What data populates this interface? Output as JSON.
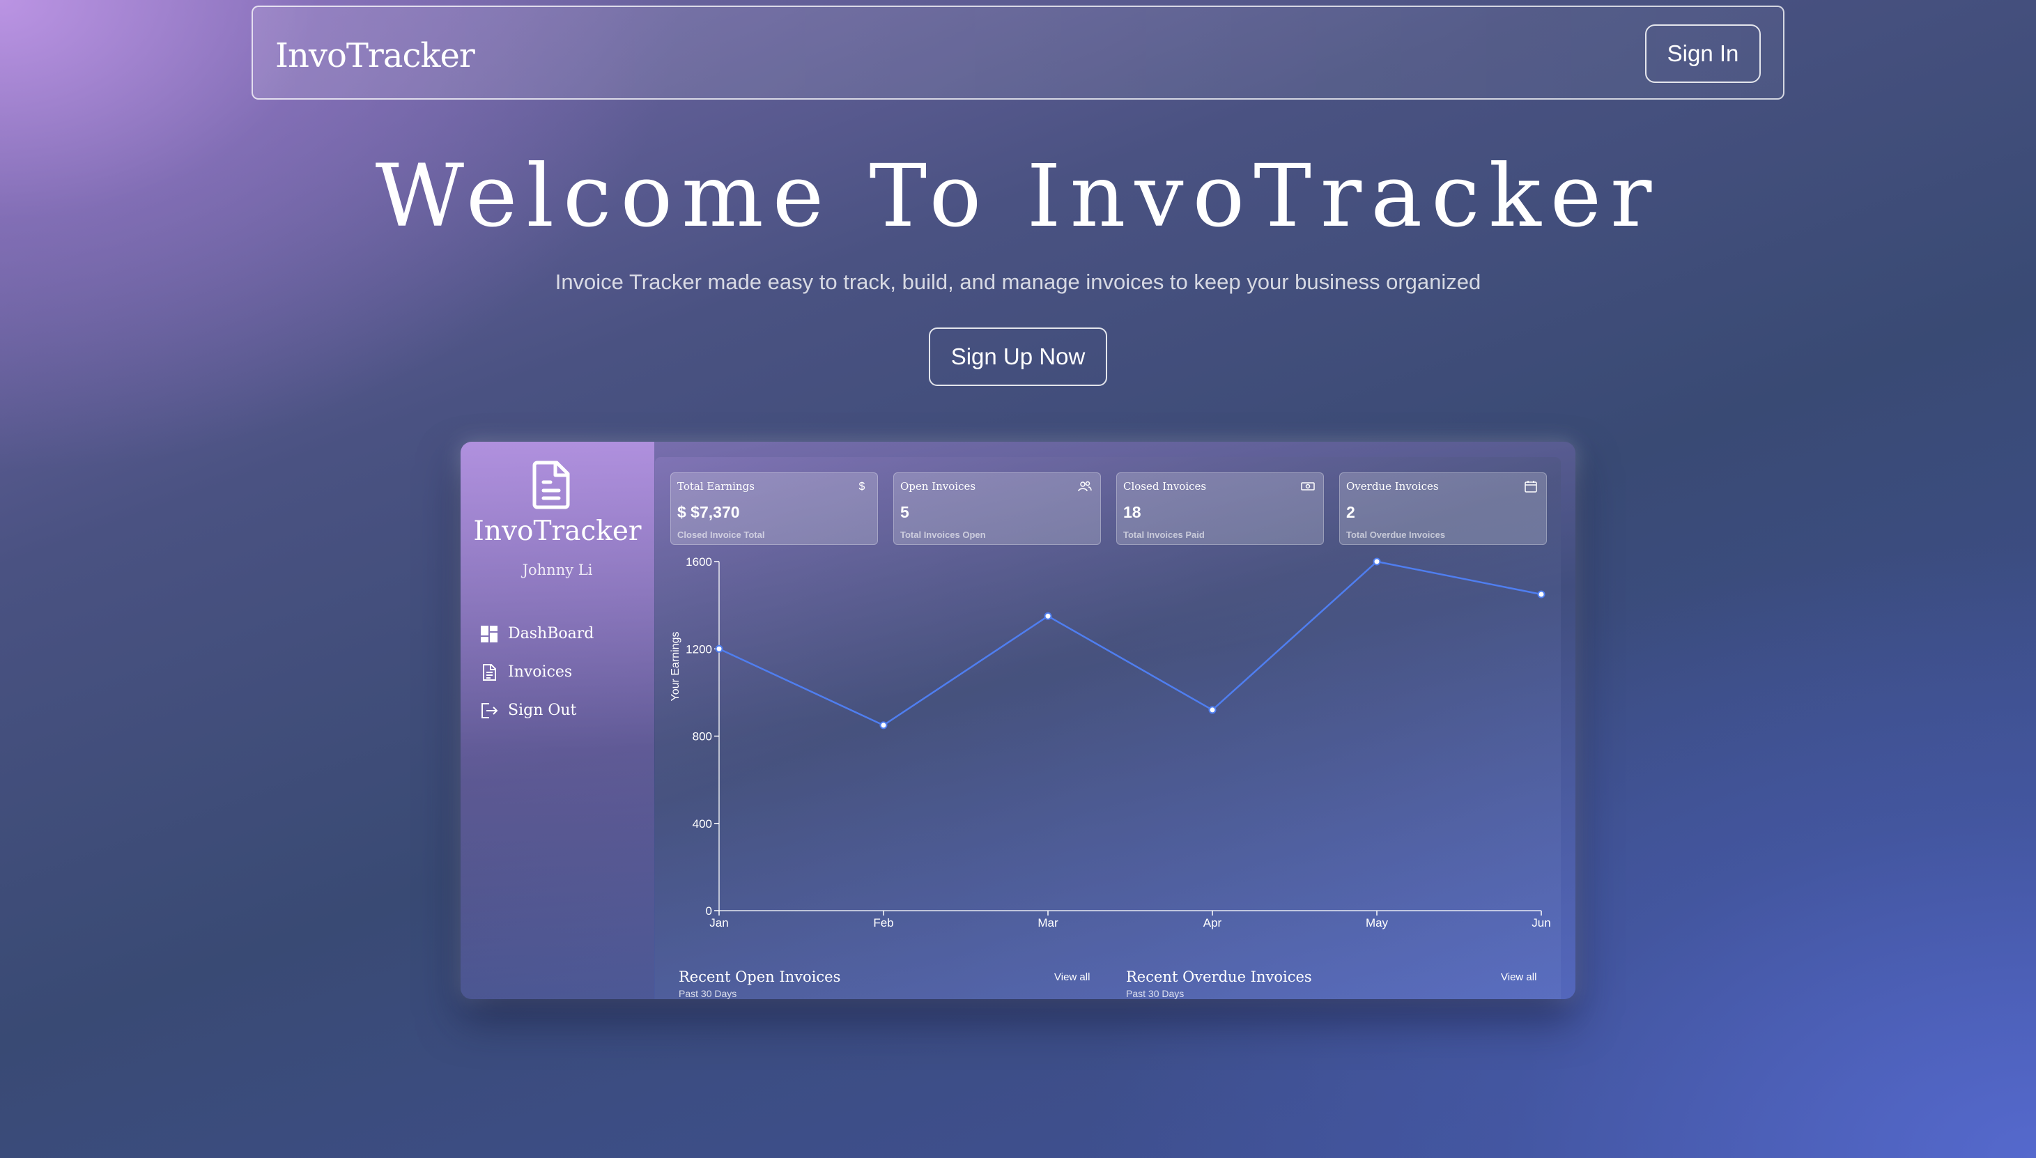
{
  "navbar": {
    "brand": "InvoTracker",
    "signin_label": "Sign In"
  },
  "hero": {
    "title": "Welcome To InvoTracker",
    "subtitle": "Invoice Tracker made easy to track, build, and manage invoices to keep your business organized",
    "cta_label": "Sign Up Now"
  },
  "preview": {
    "sidebar": {
      "logo_icon": "document-icon",
      "brand": "InvoTracker",
      "user": "Johnny Li",
      "items": [
        {
          "label": "DashBoard",
          "icon": "dashboard-icon"
        },
        {
          "label": "Invoices",
          "icon": "invoice-icon"
        },
        {
          "label": "Sign Out",
          "icon": "sign-out-icon"
        }
      ]
    },
    "kpis": [
      {
        "title": "Total Earnings",
        "value": "$ $7,370",
        "desc": "Closed Invoice Total",
        "icon": "dollar-icon"
      },
      {
        "title": "Open Invoices",
        "value": "5",
        "desc": "Total Invoices Open",
        "icon": "users-icon"
      },
      {
        "title": "Closed Invoices",
        "value": "18",
        "desc": "Total Invoices Paid",
        "icon": "cash-icon"
      },
      {
        "title": "Overdue Invoices",
        "value": "2",
        "desc": "Total Overdue Invoices",
        "icon": "calendar-icon"
      }
    ],
    "recent": [
      {
        "title": "Recent Open Invoices",
        "sub": "Past 30 Days",
        "view_all": "View all"
      },
      {
        "title": "Recent Overdue Invoices",
        "sub": "Past 30 Days",
        "view_all": "View all"
      }
    ]
  },
  "chart_data": {
    "type": "line",
    "categories": [
      "Jan",
      "Feb",
      "Mar",
      "Apr",
      "May",
      "Jun"
    ],
    "series": [
      {
        "values": [
          1200,
          850,
          1350,
          920,
          1600,
          1450
        ]
      }
    ],
    "ylabel": "Your Earnings",
    "ylim": [
      0,
      1600
    ],
    "yticks": [
      0,
      400,
      800,
      1200,
      1600
    ],
    "line_color": "#4f7ef0",
    "grid": false
  },
  "colors": {
    "accent_line": "#4f7ef0"
  }
}
